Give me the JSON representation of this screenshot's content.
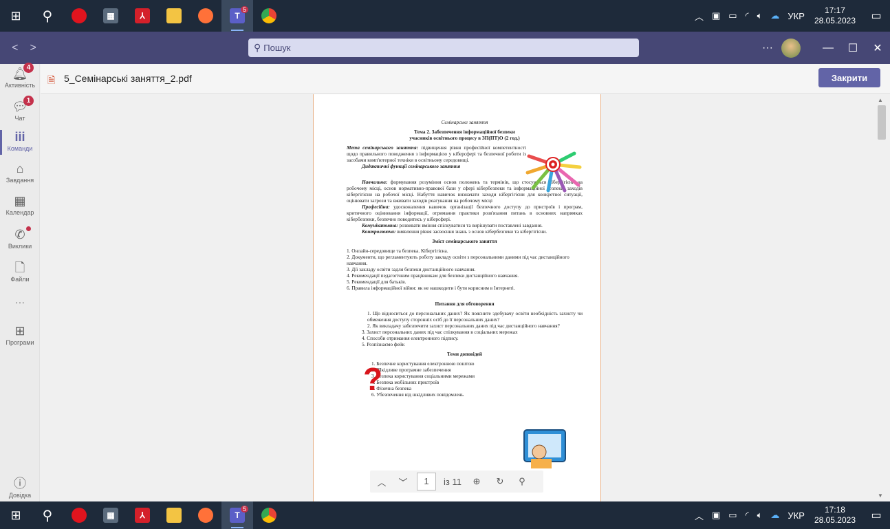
{
  "taskbar": {
    "clock_top": {
      "time": "17:17",
      "date": "28.05.2023"
    },
    "clock_bottom": {
      "time": "17:18",
      "date": "28.05.2023"
    },
    "language": "УКР",
    "teams_badge": "5"
  },
  "teams": {
    "search_placeholder": "Пошук",
    "more": "···"
  },
  "rail": {
    "activity": {
      "label": "Активність",
      "badge": "4"
    },
    "chat": {
      "label": "Чат",
      "badge": "1"
    },
    "teams": {
      "label": "Команди"
    },
    "assignments": {
      "label": "Завдання"
    },
    "calendar": {
      "label": "Календар"
    },
    "calls": {
      "label": "Виклики"
    },
    "files": {
      "label": "Файли"
    },
    "more": {
      "label": "···"
    },
    "apps": {
      "label": "Програми"
    },
    "help": {
      "label": "Довідка"
    }
  },
  "document": {
    "file_name": "5_Семінарські заняття_2.pdf",
    "close_label": "Закрити"
  },
  "pager": {
    "current_page": "1",
    "total": "із 11"
  },
  "pdf": {
    "heading_italic": "Семінарське заняття",
    "title_line1": "Тема 2. Забезпечення інформаційної безпеки",
    "title_line2": "учасників  освітнього процесу в ЗП(ПТ)О (2 год.)",
    "goal_label": "Мета семінарського заняття:",
    "goal_text": " підвищення рівня професійної компетентності щодо правильного поводження з інформацією у кіберсфері та безпечної роботи із засобами комп'ютерної техніки в освітньому середовищі.",
    "didactic_title": "Дидактичні функції семінарського заняття",
    "edu_label": "Навчальна:",
    "edu_text": " формування розуміння основ положень та термінів, що стосуються кібергігієни на робочому місці, основ нормативно-правової бази у сфері кібербезпеки та інформаційної безпеки, заходів кібергігієни на робочої місці. Набуття навичок визначати заходи кібергігієни для конкретної ситуації, оцінювати загрози та вживати заходів реагування на робочому місці",
    "prof_label": "Професійна:",
    "prof_text": " удосконалення навичок організації безпечного доступу до пристроїв і програм, критичного оцінювання інформації, отримання практики розв'язання питань в основних напрямках кібербезпеки, безпечно поводитись у кіберсфері.",
    "comm_label": "Комунікативна:",
    "comm_text": " розвивати вміння спілкуватися та вирішувати поставлені завдання.",
    "ctrl_label": "Контролююча:",
    "ctrl_text": " виявлення рівня засвоєння знань з основ кібербезпеки та кібергігієни.",
    "content_title": "Зміст семінарського заняття",
    "content_items": [
      "1. Онлайн-середовище та безпека. Кібергігієна.",
      "2. Документи, що регламентують роботу закладу освіти з персональними даними під час дистанційного навчання.",
      "3. Дії закладу освіти задля безпеки дистанційного навчання.",
      "4. Рекомендації педагогічним працівникам для безпеки дистанційного навчання.",
      "5. Рекомендації для батьків.",
      "6. Правила інформаційної війни: як не нашкодити і бути корисним в Інтернеті."
    ],
    "discussion_title": "Питання для обговорення",
    "discussion_items": [
      "1.        Що відноситься до персональних даних? Як поясните здобувачу освіти необхідність захисту чи обмеження доступу сторонніх осіб до її персональних даних?",
      "2.   Як викладачу забезпечити захист персональних даних під час дистанційного навчання?",
      "3.  Захист персональних даних під час спілкування в соціальних мережах",
      "4.  Способи отримання електронного підпису.",
      "5.  Розпізнаємо фейк"
    ],
    "reports_title": "Теми доповідей",
    "reports_items": [
      "1.  Безпечне користування електронною поштою",
      "2.  Шкідливе програмне забезпечення",
      "3.  Безпека користування соціальними мережами",
      "4.  Безпека мобільних пристроїв",
      "5.  Фізична безпека",
      "6.  Убезпечення від шкідливих повідомлень"
    ]
  }
}
